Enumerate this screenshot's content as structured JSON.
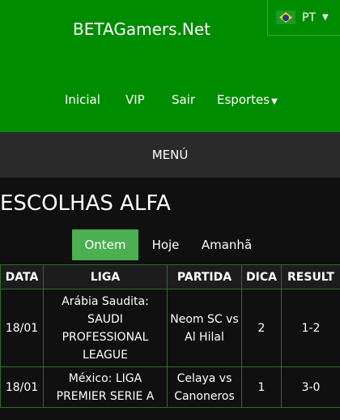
{
  "header": {
    "site_title": "BETAGamers.Net",
    "language": {
      "label": "PT",
      "flag": "brazil-flag-icon"
    }
  },
  "nav": {
    "items": [
      "Inicial",
      "VIP",
      "Sair",
      "Esportes"
    ]
  },
  "menu": {
    "label": "MENÚ"
  },
  "section": {
    "title": "ESCOLHAS ALFA"
  },
  "tabs": [
    {
      "label": "Ontem",
      "active": true
    },
    {
      "label": "Hoje",
      "active": false
    },
    {
      "label": "Amanhã",
      "active": false
    }
  ],
  "table": {
    "headers": [
      "DATA",
      "LIGA",
      "PARTIDA",
      "DICA",
      "RESULT"
    ],
    "rows": [
      {
        "data": "18/01",
        "liga": "Arábia Saudita: SAUDI PROFESSIONAL LEAGUE",
        "partida": "Neom SC vs Al Hilal",
        "dica": "2",
        "result": "1-2"
      },
      {
        "data": "18/01",
        "liga": "México: LIGA PREMIER SERIE A",
        "partida": "Celaya vs Canoneros",
        "dica": "1",
        "result": "3-0"
      }
    ]
  },
  "colors": {
    "header_green": "#008c00",
    "active_tab": "#4caf50",
    "background": "#101010",
    "menu_bar": "#2b2b2b"
  }
}
